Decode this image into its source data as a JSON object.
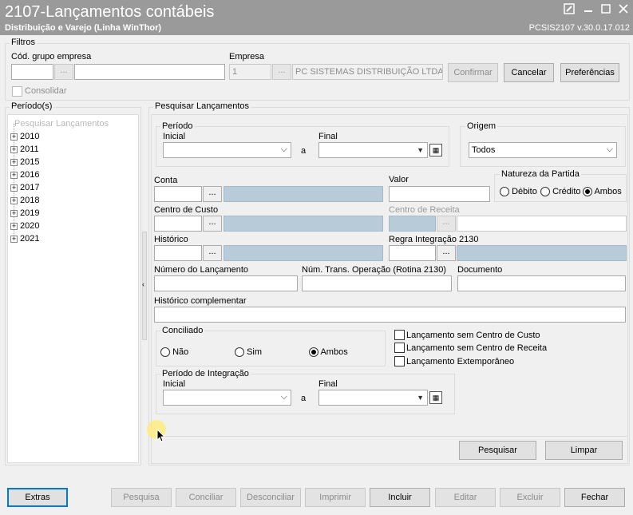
{
  "window": {
    "title": "2107-Lançamentos contábeis",
    "subtitle": "Distribuição e Varejo (Linha WinThor)",
    "version": "PCSIS2107  v.30.0.17.012"
  },
  "filtros": {
    "title": "Filtros",
    "grupo_label": "Cód. grupo empresa",
    "empresa_label": "Empresa",
    "empresa_code": "1",
    "empresa_name": "PC SISTEMAS DISTRIBUIÇÃO LTDA",
    "consolidar_label": "Consolidar",
    "confirmar": "Confirmar",
    "cancelar": "Cancelar",
    "preferencias": "Preferências",
    "ellipsis": "..."
  },
  "periodos": {
    "title": "Período(s)",
    "root": "Pesquisar Lançamentos",
    "years": [
      "2010",
      "2011",
      "2015",
      "2016",
      "2017",
      "2018",
      "2019",
      "2020",
      "2021"
    ]
  },
  "pesquisar": {
    "title": "Pesquisar Lançamentos",
    "periodo": {
      "title": "Período",
      "inicial": "Inicial",
      "final": "Final",
      "a": "a"
    },
    "origem": {
      "title": "Origem",
      "value": "Todos"
    },
    "conta": "Conta",
    "valor": "Valor",
    "natureza": {
      "title": "Natureza da Partida",
      "debito": "Débito",
      "credito": "Crédito",
      "ambos": "Ambos",
      "selected": "Ambos"
    },
    "centro_custo": "Centro de Custo",
    "centro_receita": "Centro de Receita",
    "historico": "Histórico",
    "regra": "Regra Integração 2130",
    "numero_lancamento": "Número do Lançamento",
    "num_trans": "Núm. Trans. Operação (Rotina 2130)",
    "documento": "Documento",
    "historico_complementar": "Histórico complementar",
    "conciliado": {
      "title": "Conciliado",
      "nao": "Não",
      "sim": "Sim",
      "ambos": "Ambos",
      "selected": "Ambos"
    },
    "sem_centro_custo": "Lançamento sem Centro de Custo",
    "sem_centro_receita": "Lançamento sem Centro de Receita",
    "extemporaneo": "Lançamento Extemporâneo",
    "periodo_integracao": {
      "title": "Período de Integração",
      "inicial": "Inicial",
      "final": "Final",
      "a": "a"
    },
    "pesquisar_btn": "Pesquisar",
    "limpar_btn": "Limpar"
  },
  "bottom": {
    "extras": "Extras",
    "pesquisa": "Pesquisa",
    "conciliar": "Conciliar",
    "desconciliar": "Desconciliar",
    "imprimir": "Imprimir",
    "incluir": "Incluir",
    "editar": "Editar",
    "excluir": "Excluir",
    "fechar": "Fechar"
  },
  "colors": {
    "titlebar": "#9a9a9a",
    "readonly_field": "#b8cbd9",
    "focus": "#0078d7"
  }
}
